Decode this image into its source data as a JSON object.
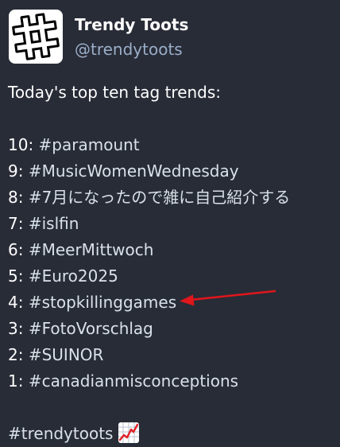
{
  "account": {
    "display_name": "Trendy Toots",
    "handle": "@trendytoots",
    "avatar_icon": "hashtag-icon"
  },
  "post": {
    "intro": "Today's top ten tag trends:",
    "trends": [
      {
        "rank": "10:",
        "tag": "#paramount"
      },
      {
        "rank": "9:",
        "tag": "#MusicWomenWednesday"
      },
      {
        "rank": "8:",
        "tag": "#7月になったので雑に自己紹介する"
      },
      {
        "rank": "7:",
        "tag": "#islfin"
      },
      {
        "rank": "6:",
        "tag": "#MeerMittwoch"
      },
      {
        "rank": "5:",
        "tag": "#Euro2025"
      },
      {
        "rank": "4:",
        "tag": "#stopkillinggames"
      },
      {
        "rank": "3:",
        "tag": "#FotoVorschlag"
      },
      {
        "rank": "2:",
        "tag": "#SUINOR"
      },
      {
        "rank": "1:",
        "tag": "#canadianmisconceptions"
      }
    ],
    "footer_tag": "#trendytoots",
    "footer_emoji": "chart-increasing-icon"
  },
  "annotation": {
    "arrow_color": "#e0161b",
    "points_to": "#stopkillinggames"
  },
  "colors": {
    "background": "#282c37",
    "text": "#ffffff",
    "handle": "#9baec8"
  }
}
